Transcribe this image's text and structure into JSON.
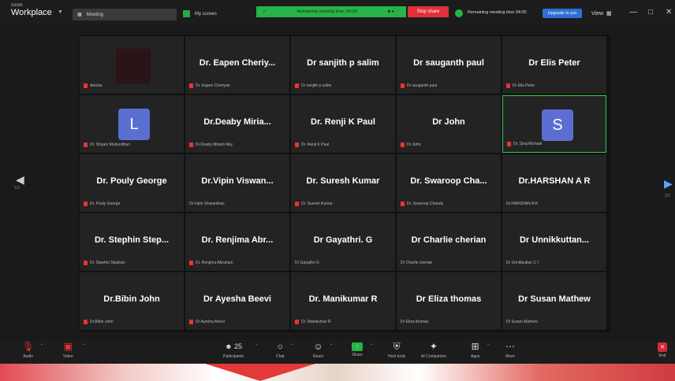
{
  "app": {
    "logo_small": "zoom",
    "logo_name": "Workplace"
  },
  "titlebar": {
    "meeting_tab": "Meeting",
    "screen_tab": "My screen",
    "green_bar_text": "Remaining meeting time: 04:00",
    "stop_share": "Stop share",
    "remaining_text": "Remaining meeting time 04:00",
    "upgrade_label": "Upgrade to pro",
    "view_label": "View"
  },
  "nav": {
    "left_page": "1/2",
    "right_page": "2/2"
  },
  "tiles": [
    {
      "name": "",
      "label": "Aiesha",
      "muted": true,
      "video": true
    },
    {
      "name": "Dr. Eapen Cheriy...",
      "label": "Dr. Eapen Cheriyan",
      "muted": true
    },
    {
      "name": "Dr sanjith p salim",
      "label": "Dr sanjith p salim",
      "muted": true
    },
    {
      "name": "Dr sauganth paul",
      "label": "Dr sauganth paul",
      "muted": true
    },
    {
      "name": "Dr Elis Peter",
      "label": "Dr Elis Peter",
      "muted": true
    },
    {
      "name": "",
      "label": "Dr. Shyam Mukundhan",
      "muted": true,
      "avatar": "L"
    },
    {
      "name": "Dr.Deaby Miria...",
      "label": "Dr.Deaby Miriam Aby",
      "muted": true
    },
    {
      "name": "Dr. Renji K Paul",
      "label": "Dr. Renji K Paul",
      "muted": true
    },
    {
      "name": "Dr John",
      "label": "Dr John",
      "muted": true
    },
    {
      "name": "",
      "label": "Dr. Siraj Michael",
      "muted": true,
      "avatar": "S",
      "active": true
    },
    {
      "name": "Dr. Pouly George",
      "label": "Dr. Pouly George",
      "muted": true
    },
    {
      "name": "Dr.Vipin Viswan...",
      "label": "Dr.Vipin Viswanthan",
      "muted": false
    },
    {
      "name": "Dr. Suresh Kumar",
      "label": "Dr. Suresh Kumar",
      "muted": true
    },
    {
      "name": "Dr. Swaroop Cha...",
      "label": "Dr. Swaroop Chandy",
      "muted": true
    },
    {
      "name": "Dr.HARSHAN A R",
      "label": "Dr.HARSHAN A R",
      "muted": false
    },
    {
      "name": "Dr. Stephin Step...",
      "label": "Dr. Stephin Stephan",
      "muted": true
    },
    {
      "name": "Dr. Renjima Abr...",
      "label": "Dr. Renjima Abraham",
      "muted": true
    },
    {
      "name": "Dr Gayathri. G",
      "label": "Dr Gayathri G",
      "muted": false
    },
    {
      "name": "Dr Charlie cherian",
      "label": "Dr Charlie cherian",
      "muted": false
    },
    {
      "name": "Dr Unnikkuttan...",
      "label": "Dr Unnikkuttan C I",
      "muted": false
    },
    {
      "name": "Dr.Bibin John",
      "label": "Dr.Bibin John",
      "muted": true
    },
    {
      "name": "Dr Ayesha Beevi",
      "label": "Dr Ayesha Beevi",
      "muted": true
    },
    {
      "name": "Dr. Manikumar R",
      "label": "Dr. Manikumar R",
      "muted": true
    },
    {
      "name": "Dr Eliza thomas",
      "label": "Dr Eliza thomas",
      "muted": false
    },
    {
      "name": "Dr Susan Mathew",
      "label": "Dr Susan Mathew",
      "muted": false
    }
  ],
  "toolbar": {
    "audio": "Audio",
    "video": "Video",
    "participants_count": "25",
    "participants": "Participants",
    "chat": "Chat",
    "react": "React",
    "share": "Share",
    "host_tools": "Host tools",
    "ai_companion": "AI Companion",
    "apps": "Apps",
    "more": "More",
    "end": "End"
  },
  "colors": {
    "active_border": "#2ecc5a",
    "share_green": "#27b347",
    "end_red": "#d42b36",
    "avatar_blue": "#5b6fd3"
  }
}
